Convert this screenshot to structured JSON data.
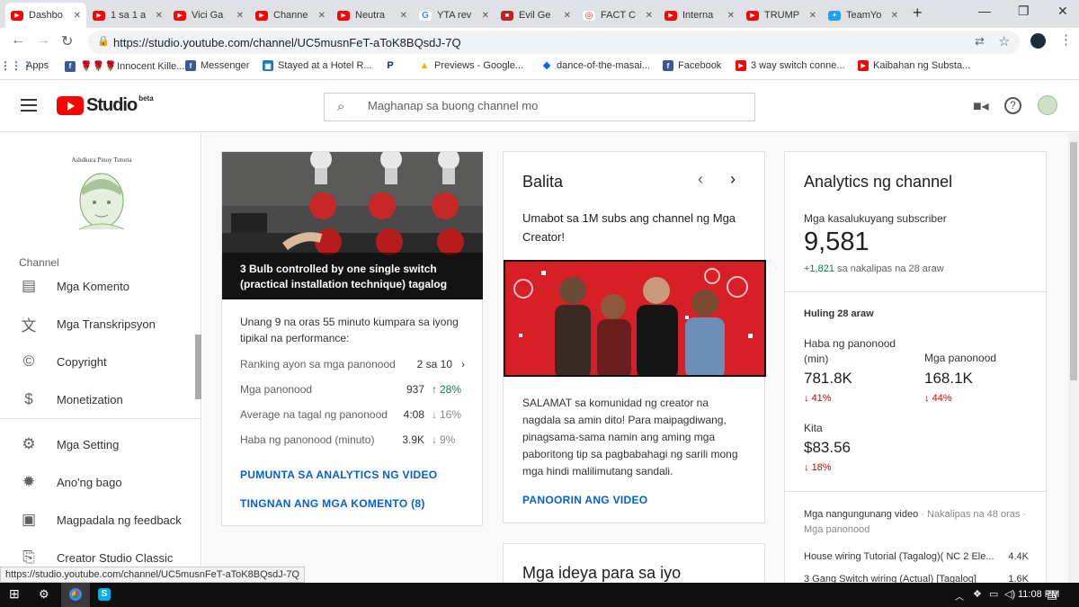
{
  "browser": {
    "tabs": [
      {
        "title": "Dashbo",
        "icon": "youtube-icon",
        "active": true
      },
      {
        "title": "1 sa 1 a",
        "icon": "youtube-icon"
      },
      {
        "title": "Vici Ga",
        "icon": "youtube-icon"
      },
      {
        "title": "Channe",
        "icon": "youtube-icon"
      },
      {
        "title": "Neutra",
        "icon": "youtube-icon"
      },
      {
        "title": "YTA rev",
        "icon": "google-icon"
      },
      {
        "title": "Evil Ge",
        "icon": "bookmark-icon"
      },
      {
        "title": "FACT C",
        "icon": "fact-icon"
      },
      {
        "title": "Interna",
        "icon": "youtube-icon"
      },
      {
        "title": "TRUMP",
        "icon": "youtube-icon"
      },
      {
        "title": "TeamYo",
        "icon": "twitter-icon"
      }
    ],
    "url": "https://studio.youtube.com/channel/UC5musnFeT-aToK8BQsdJ-7Q",
    "bookmarks": [
      {
        "label": "Apps",
        "icon": "apps-grid-icon"
      },
      {
        "label": "🌹🌹🌹Innocent Kille...",
        "icon": "facebook-icon"
      },
      {
        "label": "Messenger",
        "icon": "facebook-icon"
      },
      {
        "label": "Stayed at a Hotel R...",
        "icon": "hotel-icon"
      },
      {
        "label": "",
        "icon": "paypal-icon"
      },
      {
        "label": "Previews - Google...",
        "icon": "drive-icon"
      },
      {
        "label": "dance-of-the-masai...",
        "icon": "dropbox-icon"
      },
      {
        "label": "Facebook",
        "icon": "facebook-icon"
      },
      {
        "label": "3 way switch conne...",
        "icon": "youtube-icon"
      },
      {
        "label": "Kaibahan ng Substa...",
        "icon": "youtube-icon"
      }
    ],
    "status_url": "https://studio.youtube.com/channel/UC5musnFeT-aToK8BQsdJ-7Q"
  },
  "header": {
    "logo_text": "Studio",
    "beta_text": "beta",
    "search_placeholder": "Maghanap sa buong channel mo"
  },
  "sidebar": {
    "channel_avatar_caption": "Ashdkura Pinoy Tutoria",
    "section_label": "Channel",
    "items": [
      {
        "label": "Mga Komento",
        "icon": "comment-icon"
      },
      {
        "label": "Mga Transkripsyon",
        "icon": "translate-icon"
      },
      {
        "label": "Copyright",
        "icon": "copyright-icon"
      },
      {
        "label": "Monetization",
        "icon": "dollar-icon"
      },
      {
        "label": "Mga Setting",
        "icon": "gear-icon"
      },
      {
        "label": "Ano'ng bago",
        "icon": "whats-new-icon"
      },
      {
        "label": "Magpadala ng feedback",
        "icon": "feedback-icon"
      },
      {
        "label": "Creator Studio Classic",
        "icon": "classic-studio-icon"
      }
    ]
  },
  "video_card": {
    "title": "3 Bulb controlled by one single switch (practical installation technique) tagalog",
    "intro": "Unang 9 na oras 55 minuto kumpara sa iyong tipikal na performance:",
    "ranking_label": "Ranking ayon sa mga panonood",
    "ranking_value": "2 sa 10",
    "stats": [
      {
        "label": "Mga panonood",
        "value": "937",
        "change": "28%",
        "trend": "up"
      },
      {
        "label": "Average na tagal ng panonood",
        "value": "4:08",
        "change": "16%",
        "trend": "down-muted"
      },
      {
        "label": "Haba ng panonood (minuto)",
        "value": "3.9K",
        "change": "9%",
        "trend": "down-muted"
      }
    ],
    "link_analytics": "PUMUNTA SA ANALYTICS NG VIDEO",
    "link_comments": "TINGNAN ANG MGA KOMENTO (8)"
  },
  "news_card": {
    "title": "Balita",
    "headline": "Umabot sa 1M subs ang channel ng Mga Creator!",
    "body": "SALAMAT sa komunidad ng creator na nagdala sa amin dito! Para maipagdiwang, pinagsama-sama namin ang aming mga paboritong tip sa pagbabahagi ng sarili mong mga hindi malilimutang sandali.",
    "link": "PANOORIN ANG VIDEO"
  },
  "ideas_card": {
    "title": "Mga ideya para sa iyo"
  },
  "analytics_card": {
    "title": "Analytics ng channel",
    "subscribers_label": "Mga kasalukuyang subscriber",
    "subscribers_value": "9,581",
    "subscribers_change": "+1,821",
    "subscribers_change_suffix": "sa nakalipas na 28 araw",
    "period_label": "Huling 28 araw",
    "watch_time_label": "Haba ng panonood (min)",
    "watch_time_value": "781.8K",
    "watch_time_change": "41%",
    "views_label": "Mga panonood",
    "views_value": "168.1K",
    "views_change": "44%",
    "revenue_label": "Kita",
    "revenue_value": "$83.56",
    "revenue_change": "18%",
    "top_videos_label": "Mga nangungunang video",
    "top_videos_sub": "· Nakalipas na 48 oras · Mga panonood",
    "top_videos": [
      {
        "title": "House wiring Tutorial (Tagalog)( NC 2 Ele...",
        "views": "4.4K"
      },
      {
        "title": "3 Gang Switch wiring (Actual) [Tagalog]",
        "views": "1.6K"
      }
    ]
  },
  "taskbar": {
    "time": "11:08 PM"
  },
  "colors": {
    "youtube_red": "#ff0000",
    "link_blue": "#065fd4",
    "up_green": "#0b8043",
    "down_red": "#cc0000"
  }
}
